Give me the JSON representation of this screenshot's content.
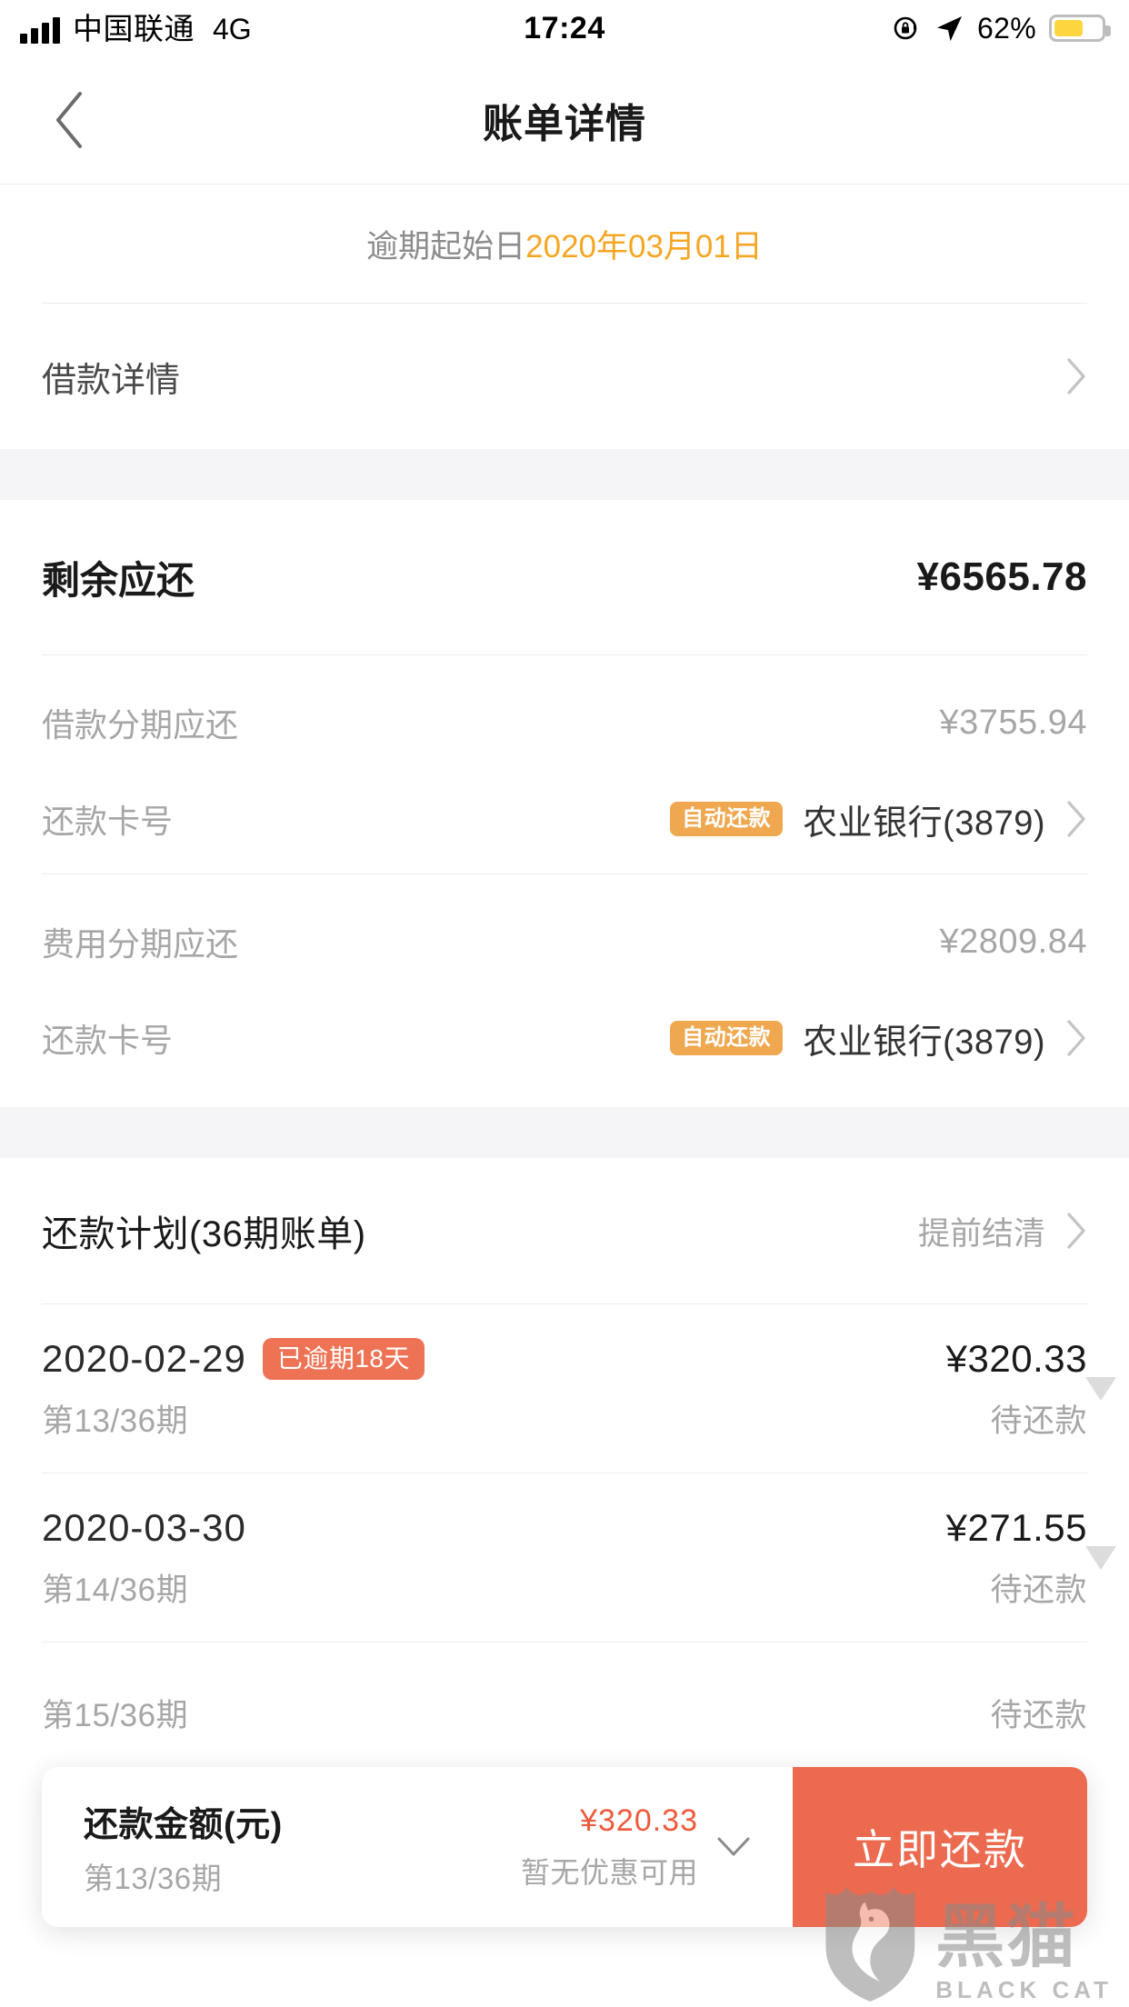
{
  "status_bar": {
    "carrier": "中国联通",
    "network": "4G",
    "time": "17:24",
    "battery_percent": "62%",
    "battery_level": 62,
    "icons": [
      "signal-bars-icon",
      "rotation-lock-icon",
      "location-arrow-icon",
      "battery-icon"
    ]
  },
  "nav": {
    "back_icon": "chevron-left-icon",
    "title": "账单详情"
  },
  "notice": {
    "label": "逾期起始日",
    "value": "2020年03月01日"
  },
  "loan_detail": {
    "label": "借款详情",
    "chevron": "chevron-right-icon"
  },
  "summary": {
    "total_label": "剩余应还",
    "total_amount": "¥6565.78",
    "groups": [
      {
        "amount_label": "借款分期应还",
        "amount_value": "¥3755.94",
        "card_label": "还款卡号",
        "card_badge": "自动还款",
        "card_name": "农业银行(3879)"
      },
      {
        "amount_label": "费用分期应还",
        "amount_value": "¥2809.84",
        "card_label": "还款卡号",
        "card_badge": "自动还款",
        "card_name": "农业银行(3879)"
      }
    ]
  },
  "plan": {
    "title": "还款计划(36期账单)",
    "action": "提前结清",
    "installments": [
      {
        "date": "2020-02-29",
        "badge": "已逾期18天",
        "term": "第13/36期",
        "amount": "¥320.33",
        "status": "待还款"
      },
      {
        "date": "2020-03-30",
        "badge": "",
        "term": "第14/36期",
        "amount": "¥271.55",
        "status": "待还款"
      },
      {
        "date": "",
        "badge": "",
        "term": "第15/36期",
        "amount": "",
        "status": "待还款"
      }
    ]
  },
  "paybar": {
    "title": "还款金额(元)",
    "term": "第13/36期",
    "amount": "¥320.33",
    "coupon": "暂无优惠可用",
    "expand_icon": "chevron-down-icon",
    "button": "立即还款"
  },
  "watermark": {
    "cn": "黑猫",
    "en": "BLACK CAT",
    "logo": "shield-cat-icon"
  },
  "colors": {
    "orange_accent": "#f5a623",
    "badge_auto": "#f0a850",
    "badge_late": "#ee7254",
    "pay_button": "#ec6a4f",
    "pay_amount": "#ee5a3c",
    "band": "#f5f5f7",
    "battery": "#fcd53f"
  }
}
